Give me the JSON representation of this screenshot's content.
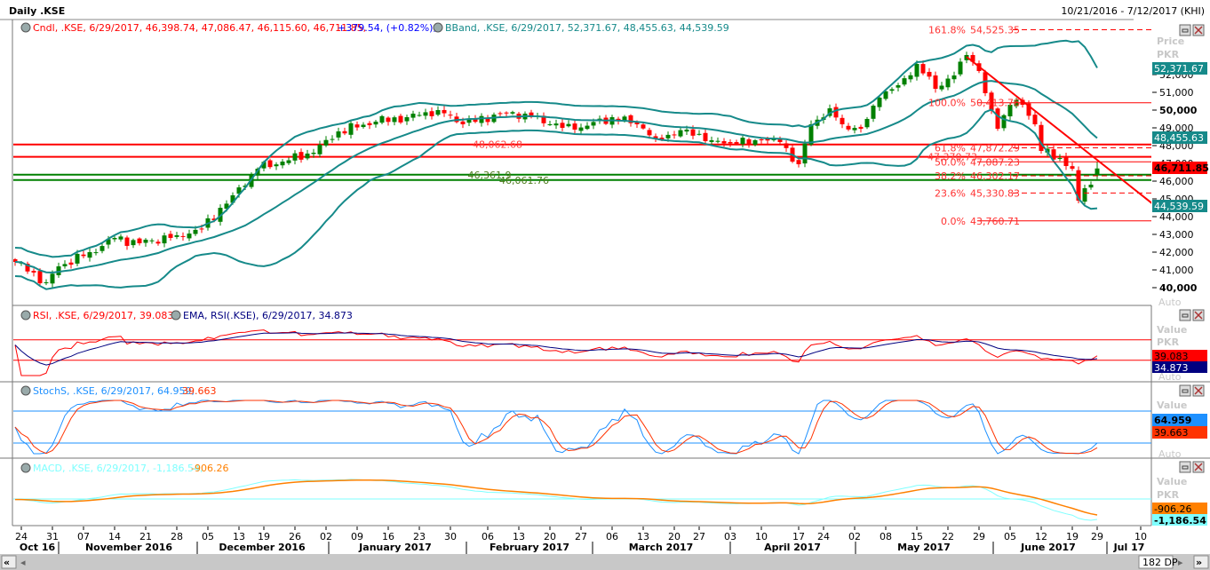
{
  "header": {
    "title": "Daily .KSE",
    "range": "10/21/2016 - 7/12/2017 (KHI)"
  },
  "legend": {
    "candle": "Cndl, .KSE, 6/29/2017, 46,398.74, 47,086.47, 46,115.60, 46,711.85,",
    "change": "+379.54, (+0.82%),",
    "bband": "BBand, .KSE, 6/29/2017, 52,371.67, 48,455.63, 44,539.59",
    "rsi": "RSI, .KSE, 6/29/2017, 39.083,",
    "ema": "EMA, RSI(.KSE), 6/29/2017, 34.873",
    "stoch_k": "StochS, .KSE, 6/29/2017, 64.959,",
    "stoch_d": "39.663",
    "macd": "MACD, .KSE, 6/29/2017, -1,186.54,",
    "macd_sig": "-906.26"
  },
  "axis": {
    "price_title": "Price",
    "currency": "PKR",
    "value_title": "Value",
    "auto": "Auto",
    "price_ticks": [
      "52,000",
      "51,000",
      "50,000",
      "49,000",
      "48,000",
      "47,000",
      "46,000",
      "45,000",
      "44,000",
      "43,000",
      "42,000",
      "41,000",
      "40,000"
    ],
    "bb_upper": "52,371.67",
    "bb_mid": "48,455.63",
    "last": "46,711.85",
    "bb_lower": "44,539.59",
    "rsi_val": "39.083",
    "ema_val": "34.873",
    "k_val": "64.959",
    "d_val": "39.663",
    "macd_sig_val": "-906.26",
    "macd_val": "-1,186.54"
  },
  "footer": {
    "dp": "182 DP",
    "months": [
      "Oct 16",
      "November 2016",
      "December 2016",
      "January 2017",
      "February 2017",
      "March 2017",
      "April 2017",
      "May 2017",
      "June 2017",
      "Jul 17"
    ]
  },
  "colors": {
    "up": "#008000",
    "down": "#ff0000",
    "band": "#168a8a",
    "rsi": "#ff0000",
    "ema": "#000080",
    "k": "#1e90ff",
    "d": "#ff3300",
    "macd": "#7fffff",
    "signal": "#ff8000"
  },
  "chart_data": {
    "type": "candlestick",
    "x_unit": "trading day index",
    "keypoints": [
      [
        0,
        41450
      ],
      [
        5,
        40300
      ],
      [
        7,
        41200
      ],
      [
        12,
        42000
      ],
      [
        16,
        42800
      ],
      [
        20,
        42500
      ],
      [
        26,
        42950
      ],
      [
        30,
        43300
      ],
      [
        35,
        45200
      ],
      [
        39,
        46700
      ],
      [
        43,
        47100
      ],
      [
        48,
        47600
      ],
      [
        52,
        48800
      ],
      [
        58,
        49350
      ],
      [
        63,
        49600
      ],
      [
        68,
        50000
      ],
      [
        70,
        49700
      ],
      [
        72,
        49200
      ],
      [
        78,
        49800
      ],
      [
        82,
        49800
      ],
      [
        86,
        49200
      ],
      [
        90,
        48900
      ],
      [
        96,
        49600
      ],
      [
        100,
        49200
      ],
      [
        103,
        48400
      ],
      [
        108,
        48900
      ],
      [
        112,
        48300
      ],
      [
        116,
        48100
      ],
      [
        120,
        48300
      ],
      [
        123,
        48200
      ],
      [
        126,
        46950
      ],
      [
        128,
        49200
      ],
      [
        131,
        50100
      ],
      [
        133,
        49200
      ],
      [
        136,
        48950
      ],
      [
        139,
        50700
      ],
      [
        142,
        51400
      ],
      [
        145,
        52600
      ],
      [
        148,
        51200
      ],
      [
        151,
        51950
      ],
      [
        153,
        53100
      ],
      [
        155,
        52200
      ],
      [
        156,
        50950
      ],
      [
        158,
        48950
      ],
      [
        160,
        50300
      ],
      [
        162,
        50300
      ],
      [
        164,
        49200
      ],
      [
        165,
        47700
      ],
      [
        168,
        47300
      ],
      [
        170,
        46700
      ],
      [
        171,
        44900
      ],
      [
        172,
        45600
      ],
      [
        173,
        45800
      ],
      [
        174,
        46711.85
      ]
    ],
    "last_bar": {
      "date": "6/29/2017",
      "open": 46398.74,
      "high": 47086.47,
      "low": 46115.6,
      "close": 46711.85
    },
    "ylim": [
      39500,
      55500
    ],
    "hlines": [
      {
        "value": 48062.68,
        "label": "48,062.68",
        "color": "#ff0000"
      },
      {
        "value": 47370.73,
        "label": "47,370.73",
        "color": "#ff0000"
      },
      {
        "value": 46361.9,
        "label": "46,361.9",
        "color": "#008000"
      },
      {
        "value": 46061.76,
        "label": "46,061.76",
        "color": "#008000"
      }
    ],
    "fib": [
      {
        "pct": "161.8%",
        "value": 54525.35,
        "label": "54,525.35",
        "dash": true
      },
      {
        "pct": "100.0%",
        "value": 50413.76,
        "label": "50,413.76",
        "dash": false
      },
      {
        "pct": "61.8%",
        "value": 47872.29,
        "label": "47,872.29",
        "dash": true
      },
      {
        "pct": "50.0%",
        "value": 47087.23,
        "label": "47,087.23",
        "dash": false
      },
      {
        "pct": "38.2%",
        "value": 46302.17,
        "label": "46,302.17",
        "dash": true
      },
      {
        "pct": "23.6%",
        "value": 45330.83,
        "label": "45,330.83",
        "dash": true
      },
      {
        "pct": "0.0%",
        "value": 43760.71,
        "label": "43,760.71",
        "dash": false
      }
    ],
    "trendline": [
      [
        153,
        53000
      ],
      [
        183,
        44700
      ]
    ],
    "rsi_levels": [
      70,
      30
    ],
    "stoch_levels": [
      80,
      20
    ],
    "date_ticks": [
      [
        "24",
        1
      ],
      [
        "31",
        6
      ],
      [
        "07",
        11
      ],
      [
        "14",
        16
      ],
      [
        "21",
        21
      ],
      [
        "28",
        26
      ],
      [
        "05",
        31
      ],
      [
        "13",
        36
      ],
      [
        "19",
        40
      ],
      [
        "26",
        45
      ],
      [
        "02",
        50
      ],
      [
        "09",
        55
      ],
      [
        "16",
        60
      ],
      [
        "23",
        65
      ],
      [
        "30",
        70
      ],
      [
        "06",
        76
      ],
      [
        "13",
        81
      ],
      [
        "20",
        86
      ],
      [
        "27",
        91
      ],
      [
        "06",
        96
      ],
      [
        "13",
        101
      ],
      [
        "20",
        106
      ],
      [
        "27",
        110
      ],
      [
        "03",
        115
      ],
      [
        "10",
        120
      ],
      [
        "17",
        126
      ],
      [
        "24",
        130
      ],
      [
        "02",
        135
      ],
      [
        "08",
        140
      ],
      [
        "15",
        145
      ],
      [
        "22",
        150
      ],
      [
        "29",
        155
      ],
      [
        "05",
        160
      ],
      [
        "12",
        165
      ],
      [
        "19",
        170
      ],
      [
        "29",
        174
      ],
      [
        "10",
        181
      ]
    ]
  }
}
